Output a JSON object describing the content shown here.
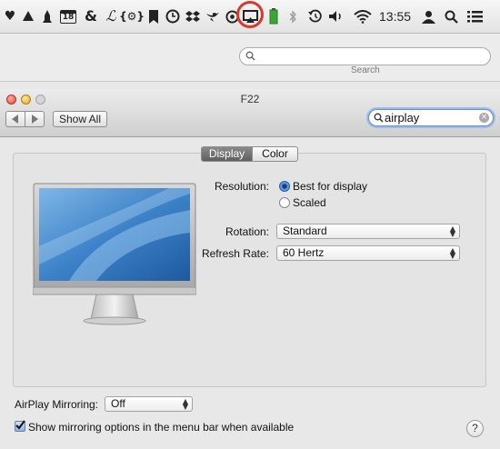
{
  "menubar": {
    "clock": "13:55",
    "icons": [
      "heart-icon",
      "recycle-icon",
      "rocket-icon",
      "calendar-icon",
      "ampersand-icon",
      "script-icon",
      "gear-bracket-icon",
      "bookmark-icon",
      "time-machine-icon",
      "dropbox-icon",
      "bird-icon",
      "sync-icon",
      "airplay-icon",
      "battery-icon",
      "bluetooth-icon",
      "history-icon",
      "volume-icon",
      "wifi-icon",
      "user-icon",
      "spotlight-icon",
      "list-icon"
    ],
    "calendar_day": "18",
    "ampersand": "&",
    "script_glyph": "ℒ",
    "gear_bracket": "{⚙}"
  },
  "background_window": {
    "search_label": "Search"
  },
  "window": {
    "title": "F22",
    "show_all": "Show All",
    "search_value": "airplay"
  },
  "tabs": [
    {
      "label": "Display",
      "selected": true
    },
    {
      "label": "Color",
      "selected": false
    }
  ],
  "display": {
    "resolution_label": "Resolution:",
    "resolution_options": [
      {
        "label": "Best for display",
        "selected": true
      },
      {
        "label": "Scaled",
        "selected": false
      }
    ],
    "rotation_label": "Rotation:",
    "rotation_value": "Standard",
    "refresh_label": "Refresh Rate:",
    "refresh_value": "60 Hertz"
  },
  "airplay": {
    "mirroring_label": "AirPlay Mirroring:",
    "mirroring_value": "Off",
    "show_in_menubar_label": "Show mirroring options in the menu bar when available",
    "show_in_menubar_checked": true
  },
  "help": "?",
  "colors": {
    "highlight_circle": "#d83a2a",
    "selected_tab": "#6e6e6e",
    "radio_selected": "#3b7bd8"
  }
}
